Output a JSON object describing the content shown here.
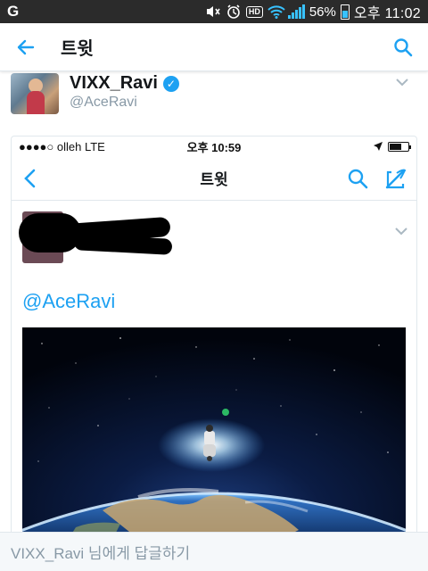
{
  "status_bar": {
    "left_icon": "G",
    "battery": "56%",
    "time": "오후 11:02",
    "icons": [
      "mute-icon",
      "alarm-icon",
      "hd-icon",
      "wifi-icon",
      "signal-icon",
      "battery-icon"
    ],
    "hd_label": "HD"
  },
  "header": {
    "title": "트윗",
    "back_icon": "arrow-left-icon",
    "search_icon": "search-icon"
  },
  "tweet": {
    "author_name": "VIXX_Ravi",
    "author_handle": "@AceRavi",
    "verified": true
  },
  "embedded_screenshot": {
    "carrier": "●●●●○ olleh  LTE",
    "time": "오후 10:59",
    "nav_title": "트윗",
    "mention": "@AceRavi"
  },
  "reply_bar": {
    "placeholder": "VIXX_Ravi 님에게 답글하기"
  },
  "colors": {
    "accent": "#1da1f2",
    "status_bar": "#2b2b2b",
    "secondary_text": "#8899a6"
  }
}
